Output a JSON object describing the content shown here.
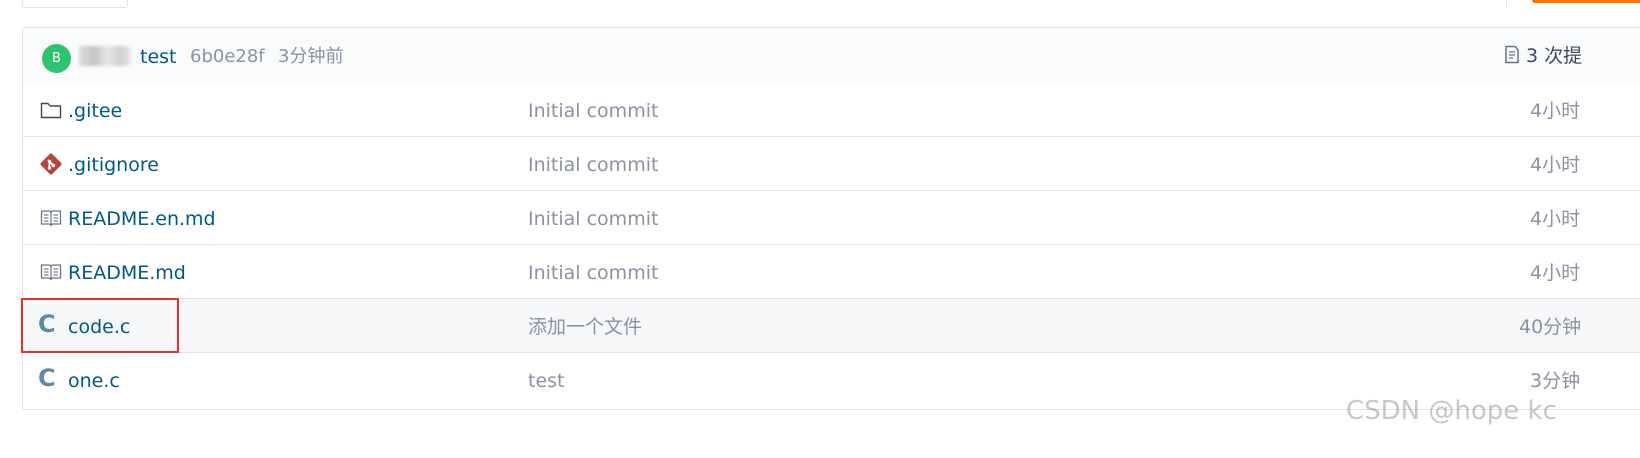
{
  "commit_header": {
    "avatar_letter": "B",
    "message": "test",
    "sha": "6b0e28f",
    "time": "3分钟前",
    "commits_count": "3 次提"
  },
  "files": [
    {
      "name": ".gitee",
      "icon": "folder-icon",
      "commit_message": "Initial commit",
      "time": "4小时"
    },
    {
      "name": ".gitignore",
      "icon": "git-icon",
      "commit_message": "Initial commit",
      "time": "4小时"
    },
    {
      "name": "README.en.md",
      "icon": "book-icon",
      "commit_message": "Initial commit",
      "time": "4小时"
    },
    {
      "name": "README.md",
      "icon": "book-icon",
      "commit_message": "Initial commit",
      "time": "4小时"
    },
    {
      "name": "code.c",
      "icon": "c-language-icon",
      "commit_message": "添加一个文件",
      "time": "40分钟"
    },
    {
      "name": "one.c",
      "icon": "c-language-icon",
      "commit_message": "test",
      "time": "3分钟"
    }
  ],
  "colors": {
    "link": "#005980",
    "muted": "#8c92a4",
    "avatar_bg": "#2ec36e",
    "git_icon": "#b4473c",
    "c_icon": "#5e8aa3",
    "highlight": "#e8302a",
    "accent_orange": "#fe7300"
  },
  "watermark": "CSDN @hope kc"
}
